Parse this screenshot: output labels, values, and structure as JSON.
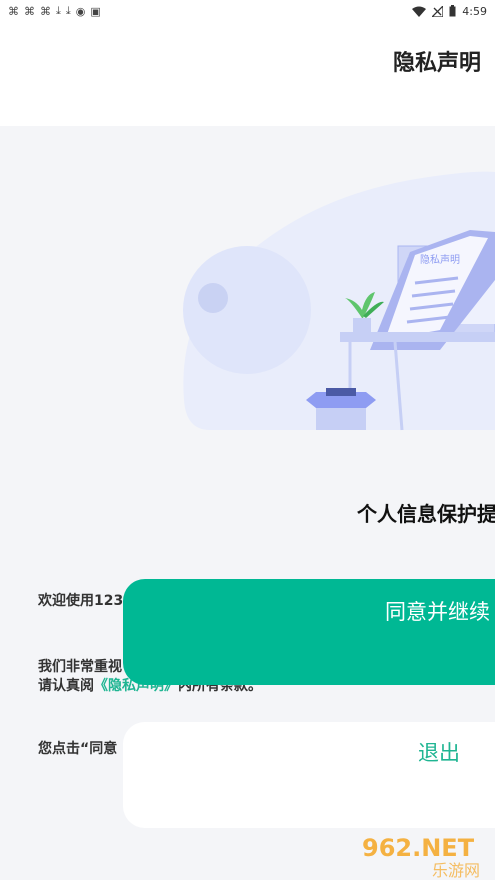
{
  "status_bar": {
    "left_icons": [
      "notification-icon",
      "notification-icon",
      "notification-icon",
      "download-icon",
      "download-icon",
      "app-icon",
      "a-icon"
    ],
    "time": "4:59"
  },
  "header": {
    "title": "隐私声明"
  },
  "illustration": {
    "doc_title": "隐私声明"
  },
  "main": {
    "heading": "个人信息保护提",
    "welcome": "欢迎使用123",
    "para2_line1": "我们非常重视",
    "para2_line2_prefix": "请认真阅",
    "para2_link": "《隐私声明》",
    "para2_line2_suffix": "内所有条款。",
    "para3": "您点击“同意"
  },
  "buttons": {
    "agree": "同意并继续",
    "exit": "退出"
  },
  "watermark": {
    "brand": "962.NET",
    "sub": "乐游网"
  },
  "colors": {
    "accent": "#00b894",
    "link": "#1fb592",
    "illustration": "#8e9cf2"
  }
}
